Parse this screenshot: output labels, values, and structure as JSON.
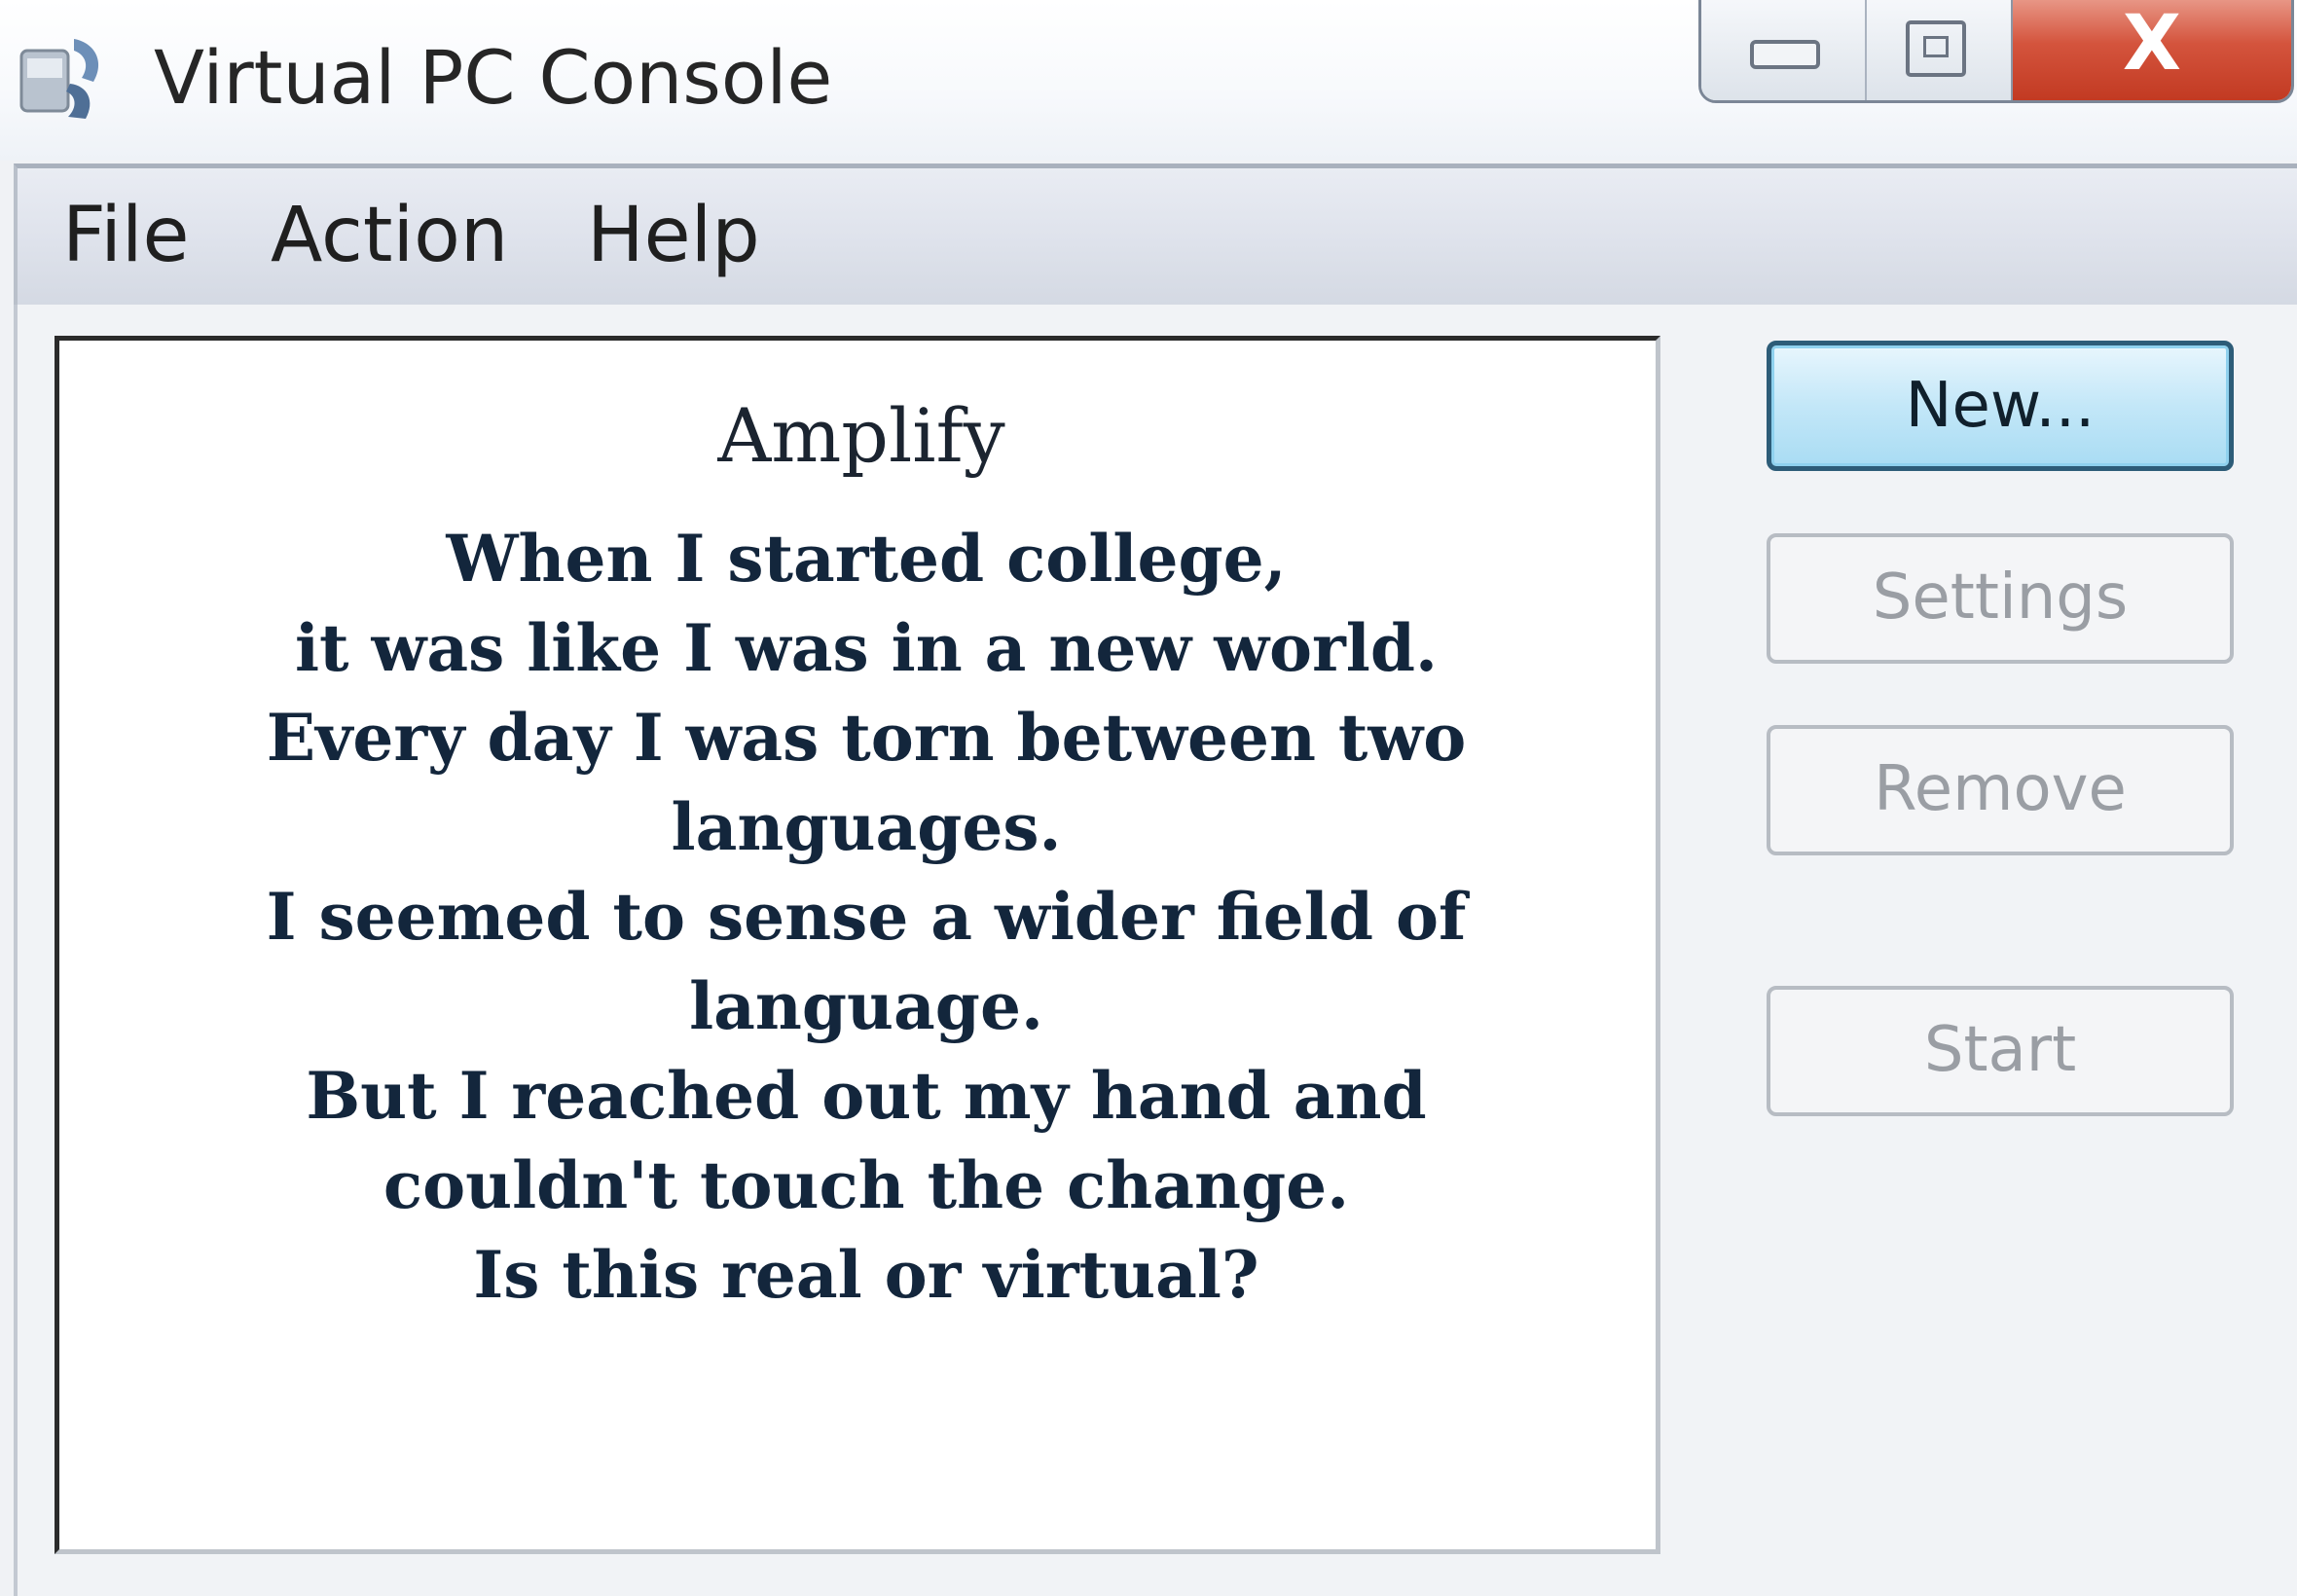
{
  "window": {
    "title": "Virtual PC Console",
    "icon": "virtual-pc-app-icon",
    "caption_buttons": {
      "minimize_icon": "minimize-icon",
      "maximize_icon": "maximize-icon",
      "close_glyph": "X"
    }
  },
  "menubar": {
    "items": [
      {
        "label": "File"
      },
      {
        "label": "Action"
      },
      {
        "label": "Help"
      }
    ]
  },
  "list": {
    "title": "Amplify",
    "lines": [
      "When I started college,",
      "it was like I was in a new world.",
      "Every day I was torn between two",
      "languages.",
      "I seemed to sense a wider field of",
      "language.",
      "But I reached out my hand and",
      "couldn't touch the change.",
      "Is this real or virtual?"
    ]
  },
  "buttons": {
    "new": "New...",
    "settings": "Settings",
    "remove": "Remove",
    "start": "Start"
  },
  "colors": {
    "close_button": "#c94a33",
    "default_button": "#b6e1f6",
    "text_dark": "#13263c"
  }
}
